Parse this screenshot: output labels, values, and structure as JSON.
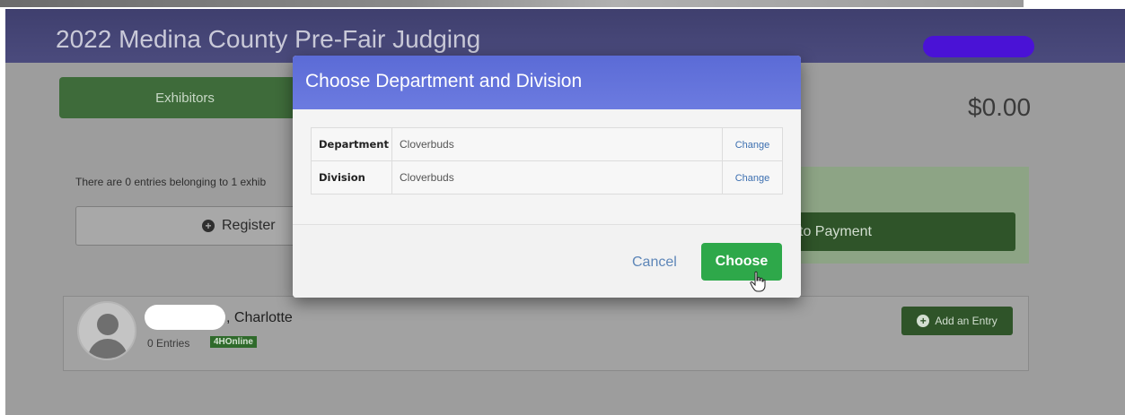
{
  "app": {
    "title": "2022 Medina County Pre-Fair Judging",
    "total": "$0.00"
  },
  "nav": {
    "exhibitors_tab": "Exhibitors"
  },
  "summary": {
    "text": "There are 0 entries belonging to 1 exhib",
    "register_label": "Register",
    "payment_label": "to Payment"
  },
  "exhibitor": {
    "name": ", Charlotte",
    "entries": "0 Entries",
    "badge": "4HOnline",
    "add_entry_label": "Add an Entry"
  },
  "modal": {
    "title": "Choose Department and Division",
    "rows": [
      {
        "label": "Department",
        "value": "Cloverbuds",
        "action": "Change"
      },
      {
        "label": "Division",
        "value": "Cloverbuds",
        "action": "Change"
      }
    ],
    "cancel_label": "Cancel",
    "choose_label": "Choose"
  },
  "colors": {
    "header_bg": "#4b4b7d",
    "modal_header_bg": "#6c7be0",
    "primary_green": "#2ea84a",
    "redaction": "#4a12d6"
  },
  "icons": {
    "register": "plus-circle-icon",
    "add_entry": "plus-circle-icon",
    "avatar": "user-silhouette-icon",
    "cursor": "hand-pointer-icon"
  }
}
